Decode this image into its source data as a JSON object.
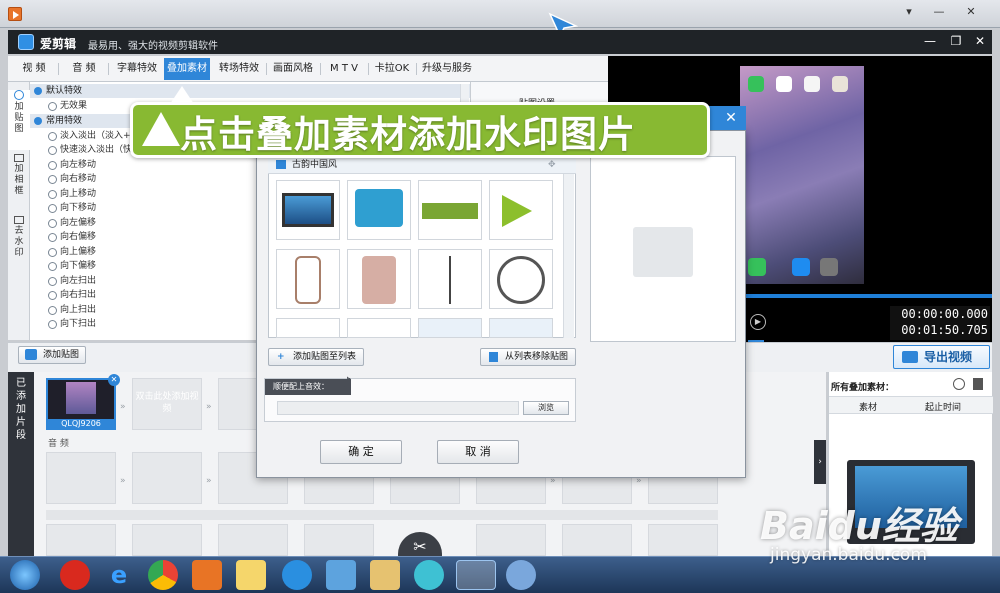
{
  "app": {
    "title": "爱剪辑",
    "subtitle": "最易用、强大的视频剪辑软件"
  },
  "tabs": [
    "视 频",
    "音 频",
    "字幕特效",
    "叠加素材",
    "转场特效",
    "画面风格",
    "M T V",
    "卡拉OK",
    "升级与服务"
  ],
  "active_tab": "叠加素材",
  "rail": {
    "add_sticker": "加贴图",
    "add_frame": "加相框",
    "remove_watermark": "去水印"
  },
  "effects": {
    "default_group": "默认特效",
    "no_effect": "无效果",
    "common_group": "常用特效",
    "items": [
      "淡入淡出（淡入+",
      "快速淡入淡出（快",
      "向左移动",
      "向右移动",
      "向上移动",
      "向下移动",
      "向左偏移",
      "向右偏移",
      "向上偏移",
      "向下偏移",
      "向左扫出",
      "向右扫出",
      "向上扫出",
      "向下扫出"
    ]
  },
  "props": {
    "title": "贴图设置"
  },
  "time": {
    "current": "00:00:00.000",
    "total": "00:01:50.705"
  },
  "toolbar": {
    "add_sticker": "添加贴图",
    "export": "导出视频"
  },
  "track": {
    "label": "已添加片段",
    "clip_name": "QLQJ9206",
    "placeholder": "双击此处添加视频",
    "audio_label": "音 频"
  },
  "side": {
    "title": "所有叠加素材：",
    "col_material": "素材",
    "col_time": "起止时间"
  },
  "dialog": {
    "category": "古韵中国风",
    "add_to_list": "添加贴图至列表",
    "remove_from_list": "从列表移除贴图",
    "audio_label": "顺便配上音效：",
    "browse": "浏览",
    "ok": "确 定",
    "cancel": "取 消"
  },
  "banner": {
    "text": "点击叠加素材添加水印图片"
  },
  "watermark": {
    "brand": "Baidu经验",
    "url": "jingyan.baidu.com"
  },
  "taskbar_icons": [
    "start-orb-icon",
    "app-red-icon",
    "ie-icon",
    "chrome-icon",
    "player-icon",
    "folder-note-icon",
    "browser-icon",
    "screen-icon",
    "explorer-icon",
    "pinwheel-icon",
    "aijianji-icon",
    "paint-icon"
  ]
}
